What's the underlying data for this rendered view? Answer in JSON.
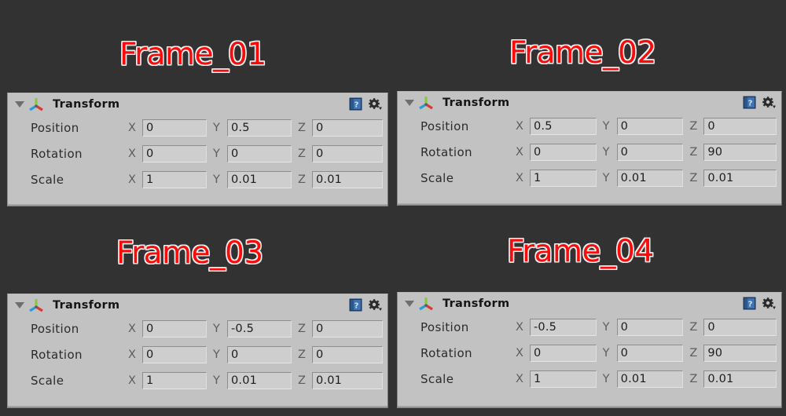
{
  "theme": {
    "background": "#333232",
    "panel_background": "#c2c2c2",
    "field_background": "#cecece",
    "title_color": "#fb0a0a",
    "title_outline": "#efefef",
    "label_color": "#2b2b2b",
    "axis_letter_color": "#5d5d5d"
  },
  "component": {
    "title": "Transform",
    "gizmo_icon": "transform-axis-gizmo-icon",
    "foldout_icon": "foldout-triangle-down-icon",
    "help_icon": "help-book-icon",
    "gear_icon": "settings-gear-icon",
    "property_labels": {
      "position": "Position",
      "rotation": "Rotation",
      "scale": "Scale"
    },
    "axis_labels": {
      "x": "X",
      "y": "Y",
      "z": "Z"
    }
  },
  "panels": [
    {
      "title": "Frame_01",
      "component_title": "Transform",
      "rows": [
        {
          "label": "Position",
          "x": "0",
          "y": "0.5",
          "z": "0"
        },
        {
          "label": "Rotation",
          "x": "0",
          "y": "0",
          "z": "0"
        },
        {
          "label": "Scale",
          "x": "1",
          "y": "0.01",
          "z": "0.01"
        }
      ]
    },
    {
      "title": "Frame_02",
      "component_title": "Transform",
      "rows": [
        {
          "label": "Position",
          "x": "0.5",
          "y": "0",
          "z": "0"
        },
        {
          "label": "Rotation",
          "x": "0",
          "y": "0",
          "z": "90"
        },
        {
          "label": "Scale",
          "x": "1",
          "y": "0.01",
          "z": "0.01"
        }
      ]
    },
    {
      "title": "Frame_03",
      "component_title": "Transform",
      "rows": [
        {
          "label": "Position",
          "x": "0",
          "y": "-0.5",
          "z": "0"
        },
        {
          "label": "Rotation",
          "x": "0",
          "y": "0",
          "z": "0"
        },
        {
          "label": "Scale",
          "x": "1",
          "y": "0.01",
          "z": "0.01"
        }
      ]
    },
    {
      "title": "Frame_04",
      "component_title": "Transform",
      "rows": [
        {
          "label": "Position",
          "x": "-0.5",
          "y": "0",
          "z": "0"
        },
        {
          "label": "Rotation",
          "x": "0",
          "y": "0",
          "z": "90"
        },
        {
          "label": "Scale",
          "x": "1",
          "y": "0.01",
          "z": "0.01"
        }
      ]
    }
  ]
}
